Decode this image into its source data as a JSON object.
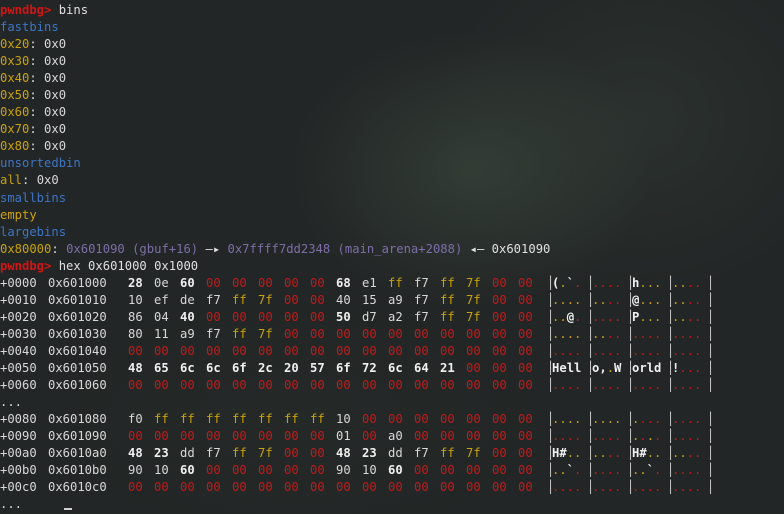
{
  "lines": {
    "l0": {
      "prompt": "pwndbg>",
      "cmd": " bins"
    },
    "l1": {
      "text": "fastbins"
    },
    "l2": {
      "key": "0x20",
      "val": ": 0x0"
    },
    "l3": {
      "key": "0x30",
      "val": ": 0x0"
    },
    "l4": {
      "key": "0x40",
      "val": ": 0x0"
    },
    "l5": {
      "key": "0x50",
      "val": ": 0x0"
    },
    "l6": {
      "key": "0x60",
      "val": ": 0x0"
    },
    "l7": {
      "key": "0x70",
      "val": ": 0x0"
    },
    "l8": {
      "key": "0x80",
      "val": ": 0x0"
    },
    "l9": {
      "text": "unsortedbin"
    },
    "l10": {
      "key": "all",
      "val": ": 0x0"
    },
    "l11": {
      "text": "smallbins"
    },
    "l12": {
      "text": "empty"
    },
    "l13": {
      "text": "largebins"
    },
    "l14": {
      "key": "0x80000",
      "colon": ": ",
      "p1": "0x601090 (gbuf+16)",
      "arr1": " —▸ ",
      "p2": "0x7ffff7dd2348 (main_arena+2088)",
      "arr2": " ◂— ",
      "p3": "0x601090"
    },
    "l15": {
      "prompt": "pwndbg>",
      "cmd": " hex 0x601000 0x1000"
    }
  },
  "hex_rows": [
    {
      "off": "+0000",
      "addr": "0x601000",
      "bytes": [
        "28",
        "0e",
        "60",
        "00",
        "00",
        "00",
        "00",
        "00",
        "68",
        "e1",
        "ff",
        "f7",
        "ff",
        "7f",
        "00",
        "00"
      ],
      "ascii": [
        "(.`.",
        "....",
        "h...",
        "...."
      ]
    },
    {
      "off": "+0010",
      "addr": "0x601010",
      "bytes": [
        "10",
        "ef",
        "de",
        "f7",
        "ff",
        "7f",
        "00",
        "00",
        "40",
        "15",
        "a9",
        "f7",
        "ff",
        "7f",
        "00",
        "00"
      ],
      "ascii": [
        "....",
        "....",
        "@...",
        "...."
      ]
    },
    {
      "off": "+0020",
      "addr": "0x601020",
      "bytes": [
        "86",
        "04",
        "40",
        "00",
        "00",
        "00",
        "00",
        "00",
        "50",
        "d7",
        "a2",
        "f7",
        "ff",
        "7f",
        "00",
        "00"
      ],
      "ascii": [
        "..@.",
        "....",
        "P...",
        "...."
      ]
    },
    {
      "off": "+0030",
      "addr": "0x601030",
      "bytes": [
        "80",
        "11",
        "a9",
        "f7",
        "ff",
        "7f",
        "00",
        "00",
        "00",
        "00",
        "00",
        "00",
        "00",
        "00",
        "00",
        "00"
      ],
      "ascii": [
        "....",
        "....",
        "....",
        "...."
      ]
    },
    {
      "off": "+0040",
      "addr": "0x601040",
      "bytes": [
        "00",
        "00",
        "00",
        "00",
        "00",
        "00",
        "00",
        "00",
        "00",
        "00",
        "00",
        "00",
        "00",
        "00",
        "00",
        "00"
      ],
      "ascii": [
        "....",
        "....",
        "....",
        "...."
      ]
    },
    {
      "off": "+0050",
      "addr": "0x601050",
      "bytes": [
        "48",
        "65",
        "6c",
        "6c",
        "6f",
        "2c",
        "20",
        "57",
        "6f",
        "72",
        "6c",
        "64",
        "21",
        "00",
        "00",
        "00"
      ],
      "ascii": [
        "Hell",
        "o,.W",
        "orld",
        "!..."
      ]
    },
    {
      "off": "+0060",
      "addr": "0x601060",
      "bytes": [
        "00",
        "00",
        "00",
        "00",
        "00",
        "00",
        "00",
        "00",
        "00",
        "00",
        "00",
        "00",
        "00",
        "00",
        "00",
        "00"
      ],
      "ascii": [
        "....",
        "....",
        "....",
        "...."
      ]
    },
    {
      "skip": "..."
    },
    {
      "off": "+0080",
      "addr": "0x601080",
      "bytes": [
        "f0",
        "ff",
        "ff",
        "ff",
        "ff",
        "ff",
        "ff",
        "ff",
        "10",
        "00",
        "00",
        "00",
        "00",
        "00",
        "00",
        "00"
      ],
      "ascii": [
        "....",
        "....",
        "....",
        "...."
      ]
    },
    {
      "off": "+0090",
      "addr": "0x601090",
      "bytes": [
        "00",
        "00",
        "00",
        "00",
        "00",
        "00",
        "00",
        "00",
        "01",
        "00",
        "a0",
        "00",
        "00",
        "00",
        "00",
        "00"
      ],
      "ascii": [
        "....",
        "....",
        "....",
        "...."
      ]
    },
    {
      "off": "+00a0",
      "addr": "0x6010a0",
      "bytes": [
        "48",
        "23",
        "dd",
        "f7",
        "ff",
        "7f",
        "00",
        "00",
        "48",
        "23",
        "dd",
        "f7",
        "ff",
        "7f",
        "00",
        "00"
      ],
      "ascii": [
        "H#..",
        "....",
        "H#..",
        "...."
      ]
    },
    {
      "off": "+00b0",
      "addr": "0x6010b0",
      "bytes": [
        "90",
        "10",
        "60",
        "00",
        "00",
        "00",
        "00",
        "00",
        "90",
        "10",
        "60",
        "00",
        "00",
        "00",
        "00",
        "00"
      ],
      "ascii": [
        "..`.",
        "....",
        "..`.",
        "...."
      ]
    },
    {
      "off": "+00c0",
      "addr": "0x6010c0",
      "bytes": [
        "00",
        "00",
        "00",
        "00",
        "00",
        "00",
        "00",
        "00",
        "00",
        "00",
        "00",
        "00",
        "00",
        "00",
        "00",
        "00"
      ],
      "ascii": [
        "....",
        "....",
        "....",
        "...."
      ]
    },
    {
      "skip": "..."
    }
  ],
  "colors": {
    "prompt": "#d11515",
    "heading": "#3d76c4",
    "size": "#c9a20a",
    "null_byte": "#c21a1a",
    "ff_byte": "#c9a20a",
    "pointer": "#7d6ea8"
  }
}
